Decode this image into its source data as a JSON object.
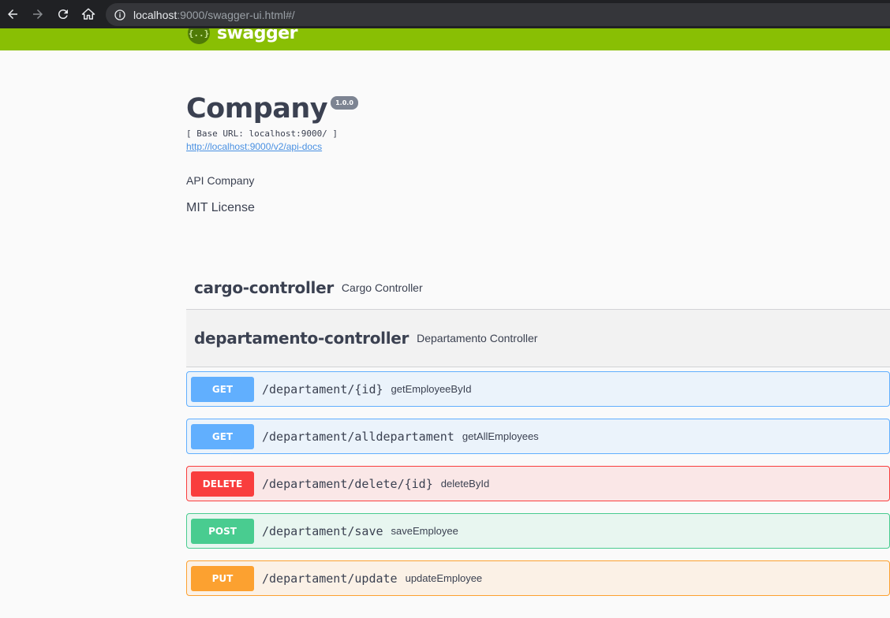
{
  "browser": {
    "url_host": "localhost",
    "url_rest": ":9000/swagger-ui.html#/"
  },
  "topbar": {
    "logo_text": "swagger",
    "logo_mark": "{..}"
  },
  "api": {
    "title": "Company",
    "version": "1.0.0",
    "base_url": "[ Base URL: localhost:9000/ ]",
    "docs_link": "http://localhost:9000/v2/api-docs",
    "description": "API Company",
    "license": "MIT License"
  },
  "tags": [
    {
      "name": "cargo-controller",
      "description": "Cargo Controller"
    },
    {
      "name": "departamento-controller",
      "description": "Departamento Controller"
    }
  ],
  "operations": [
    {
      "method": "GET",
      "path": "/departament/{id}",
      "summary": "getEmployeeById"
    },
    {
      "method": "GET",
      "path": "/departament/alldepartament",
      "summary": "getAllEmployees"
    },
    {
      "method": "DELETE",
      "path": "/departament/delete/{id}",
      "summary": "deleteById"
    },
    {
      "method": "POST",
      "path": "/departament/save",
      "summary": "saveEmployee"
    },
    {
      "method": "PUT",
      "path": "/departament/update",
      "summary": "updateEmployee"
    }
  ],
  "colors": {
    "topbar": "#89bf04",
    "get": "#61affe",
    "delete": "#f93e3e",
    "post": "#49cc90",
    "put": "#fca130",
    "text": "#3b4151"
  },
  "icons": [
    "back-arrow-icon",
    "forward-arrow-icon",
    "reload-icon",
    "home-icon",
    "info-icon"
  ]
}
